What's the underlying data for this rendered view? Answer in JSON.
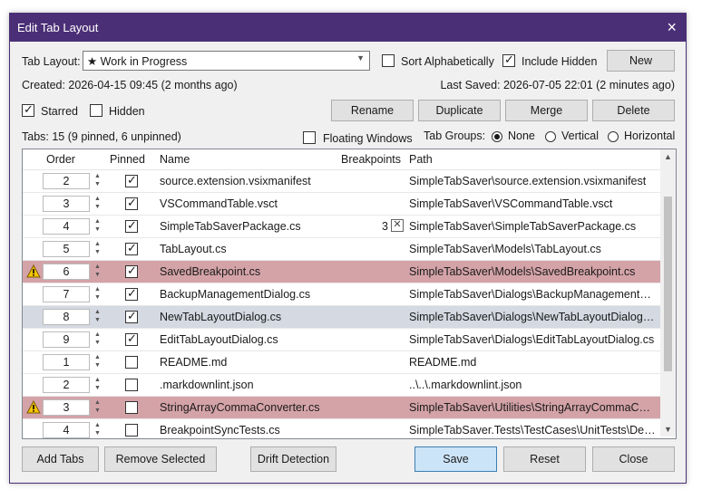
{
  "window": {
    "title": "Edit Tab Layout",
    "close_icon": "×"
  },
  "layout": {
    "label": "Tab Layout:",
    "value": "★ Work in Progress",
    "sort_label": "Sort Alphabetically",
    "sort_checked": false,
    "include_hidden_label": "Include Hidden",
    "include_hidden_checked": true,
    "new_label": "New"
  },
  "info": {
    "created": "Created: 2026-04-15 09:45 (2 months ago)",
    "last_saved": "Last Saved: 2026-07-05 22:01 (2 minutes ago)"
  },
  "flags": {
    "starred_label": "Starred",
    "starred_checked": true,
    "hidden_label": "Hidden",
    "hidden_checked": false
  },
  "actions": {
    "rename": "Rename",
    "duplicate": "Duplicate",
    "merge": "Merge",
    "delete": "Delete"
  },
  "tabs_summary": "Tabs: 15 (9 pinned, 6 unpinned)",
  "floating": {
    "label": "Floating Windows",
    "checked": false
  },
  "groups": {
    "label": "Tab Groups:",
    "options": [
      "None",
      "Vertical",
      "Horizontal"
    ],
    "selected": "None"
  },
  "grid": {
    "columns": {
      "order": "Order",
      "pinned": "Pinned",
      "name": "Name",
      "breakpoints": "Breakpoints",
      "path": "Path"
    },
    "rows": [
      {
        "order": "2",
        "pinned": true,
        "name": "source.extension.vsixmanifest",
        "breakpoints": "",
        "path": "SimpleTabSaver\\source.extension.vsixmanifest",
        "state": "normal"
      },
      {
        "order": "3",
        "pinned": true,
        "name": "VSCommandTable.vsct",
        "breakpoints": "",
        "path": "SimpleTabSaver\\VSCommandTable.vsct",
        "state": "normal"
      },
      {
        "order": "4",
        "pinned": true,
        "name": "SimpleTabSaverPackage.cs",
        "breakpoints": "3",
        "path": "SimpleTabSaver\\SimpleTabSaverPackage.cs",
        "state": "normal"
      },
      {
        "order": "5",
        "pinned": true,
        "name": "TabLayout.cs",
        "breakpoints": "",
        "path": "SimpleTabSaver\\Models\\TabLayout.cs",
        "state": "normal"
      },
      {
        "order": "6",
        "pinned": true,
        "name": "SavedBreakpoint.cs",
        "breakpoints": "",
        "path": "SimpleTabSaver\\Models\\SavedBreakpoint.cs",
        "state": "warn"
      },
      {
        "order": "7",
        "pinned": true,
        "name": "BackupManagementDialog.cs",
        "breakpoints": "",
        "path": "SimpleTabSaver\\Dialogs\\BackupManagementDial...",
        "state": "normal"
      },
      {
        "order": "8",
        "pinned": true,
        "name": "NewTabLayoutDialog.cs",
        "breakpoints": "",
        "path": "SimpleTabSaver\\Dialogs\\NewTabLayoutDialog.cs",
        "state": "selected"
      },
      {
        "order": "9",
        "pinned": true,
        "name": "EditTabLayoutDialog.cs",
        "breakpoints": "",
        "path": "SimpleTabSaver\\Dialogs\\EditTabLayoutDialog.cs",
        "state": "normal"
      },
      {
        "order": "1",
        "pinned": false,
        "name": "README.md",
        "breakpoints": "",
        "path": "README.md",
        "state": "normal"
      },
      {
        "order": "2",
        "pinned": false,
        "name": ".markdownlint.json",
        "breakpoints": "",
        "path": "..\\..\\.markdownlint.json",
        "state": "normal"
      },
      {
        "order": "3",
        "pinned": false,
        "name": "StringArrayCommaConverter.cs",
        "breakpoints": "",
        "path": "SimpleTabSaver\\Utilities\\StringArrayCommaConv...",
        "state": "warn"
      },
      {
        "order": "4",
        "pinned": false,
        "name": "BreakpointSyncTests.cs",
        "breakpoints": "",
        "path": "SimpleTabSaver.Tests\\TestCases\\UnitTests\\Debug...",
        "state": "normal"
      }
    ]
  },
  "footer": {
    "add_tabs": "Add Tabs",
    "remove_selected": "Remove Selected",
    "drift_detection": "Drift Detection",
    "save": "Save",
    "reset": "Reset",
    "close": "Close"
  },
  "colors": {
    "titlebar": "#4b2f76",
    "warn_row": "#d4a3a8",
    "selected_row": "#d4d9e2",
    "primary_button": "#cce4f7"
  }
}
